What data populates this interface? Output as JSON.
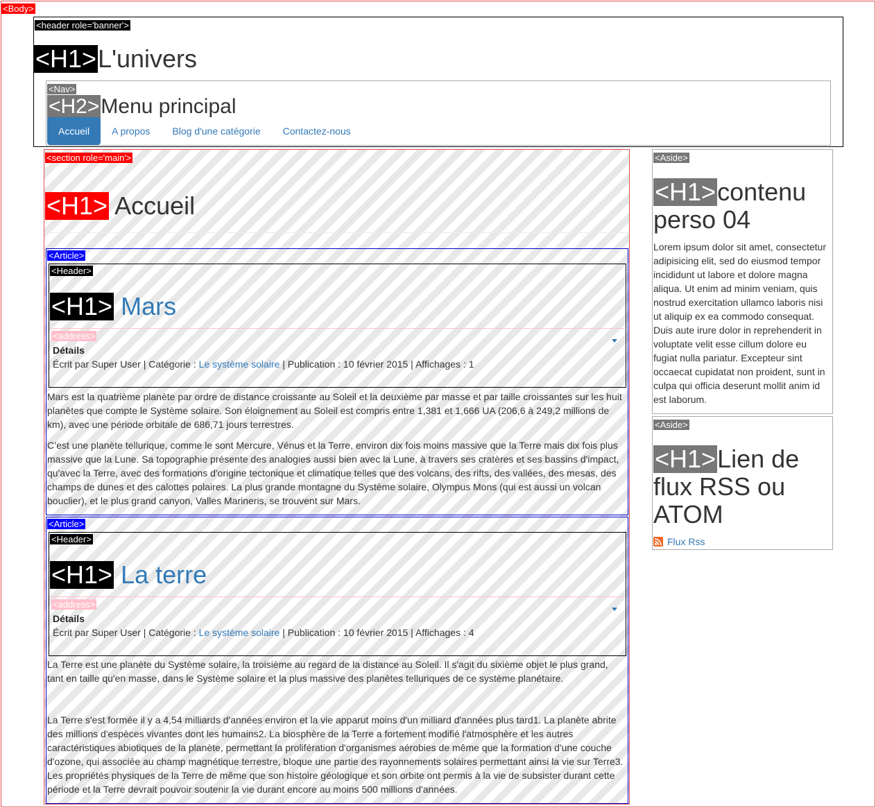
{
  "tags": {
    "body": "<Body>",
    "banner": "<header role='banner'>",
    "nav": "<Nav>",
    "main": "<section role='main'>",
    "article": "<Article>",
    "header": "<Header>",
    "address": "<address>",
    "aside": "<Aside>",
    "h1": "<H1>",
    "h2": "<H2>"
  },
  "site": {
    "title": "L'univers"
  },
  "nav": {
    "title": "Menu principal",
    "items": [
      {
        "label": "Accueil",
        "active": true
      },
      {
        "label": "A propos"
      },
      {
        "label": "Blog d'une catégorie"
      },
      {
        "label": "Contactez-nous"
      }
    ]
  },
  "main": {
    "title": "Accueil",
    "articles": [
      {
        "title": "Mars",
        "details_label": "Détails",
        "author": "Écrit par Super User | Catégorie : ",
        "category": "Le système solaire",
        "meta": " | Publication : 10 février 2015 | Affichages : 1",
        "paragraphs": [
          "Mars est la quatrième planète par ordre de distance croissante au Soleil et la deuxième par masse et par taille croissantes sur les huit planètes que compte le Système solaire. Son éloignement au Soleil est compris entre 1,381 et 1,666 UA (206,6 à 249,2 millions de km), avec une période orbitale de 686,71 jours terrestres.",
          "C’est une planète tellurique, comme le sont Mercure, Vénus et la Terre, environ dix fois moins massive que la Terre mais dix fois plus massive que la Lune. Sa topographie présente des analogies aussi bien avec la Lune, à travers ses cratères et ses bassins d'impact, qu'avec la Terre, avec des formations d'origine tectonique et climatique telles que des volcans, des rifts, des vallées, des mesas, des champs de dunes et des calottes polaires. La plus grande montagne du Système solaire, Olympus Mons (qui est aussi un volcan bouclier), et le plus grand canyon, Valles Marineris, se trouvent sur Mars."
        ]
      },
      {
        "title": "La terre",
        "details_label": "Détails",
        "author": "Écrit par Super User | Catégorie : ",
        "category": "Le système solaire",
        "meta": " | Publication : 10 février 2015 | Affichages : 4",
        "paragraphs": [
          "La Terre est une planète du Système solaire, la troisième au regard de la distance au Soleil. Il s'agit du sixième objet le plus grand, tant en taille qu'en masse, dans le Système solaire et la plus massive des planètes telluriques de ce système planétaire.",
          "La Terre s'est formée il y a 4,54 milliards d'années environ et la vie apparut moins d'un milliard d'années plus tard1. La planète abrite des millions d'espèces vivantes dont les humains2. La biosphère de la Terre a fortement modifié l'atmosphère et les autres caractéristiques abiotiques de la planète, permettant la prolifération d'organismes aérobies de même que la formation d'une couche d'ozone, qui associée au champ magnétique terrestre, bloque une partie des rayonnements solaires permettant ainsi la vie sur Terre3. Les propriétés physiques de la Terre de même que son histoire géologique et son orbite ont permis à la vie de subsister durant cette période et la Terre devrait pouvoir soutenir la vie durant encore au moins 500 millions d'années."
        ]
      }
    ]
  },
  "asides": [
    {
      "title": "contenu perso 04",
      "text": "Lorem ipsum dolor sit amet, consectetur adipisicing elit, sed do eiusmod tempor incididunt ut labore et dolore magna aliqua. Ut enim ad minim veniam, quis nostrud exercitation ullamco laboris nisi ut aliquip ex ea commodo consequat. Duis aute irure dolor in reprehenderit in voluptate velit esse cillum dolore eu fugiat nulla pariatur. Excepteur sint occaecat cupidatat non proident, sunt in culpa qui officia deserunt mollit anim id est laborum."
    },
    {
      "title": "Lien de flux RSS ou ATOM",
      "link": "Flux Rss",
      "icon": "rss-icon"
    }
  ],
  "colors": {
    "link": "#337ab7",
    "body_outline": "#e05050",
    "article_outline": "#0000cc",
    "address_tag": "#ffc0cb"
  }
}
